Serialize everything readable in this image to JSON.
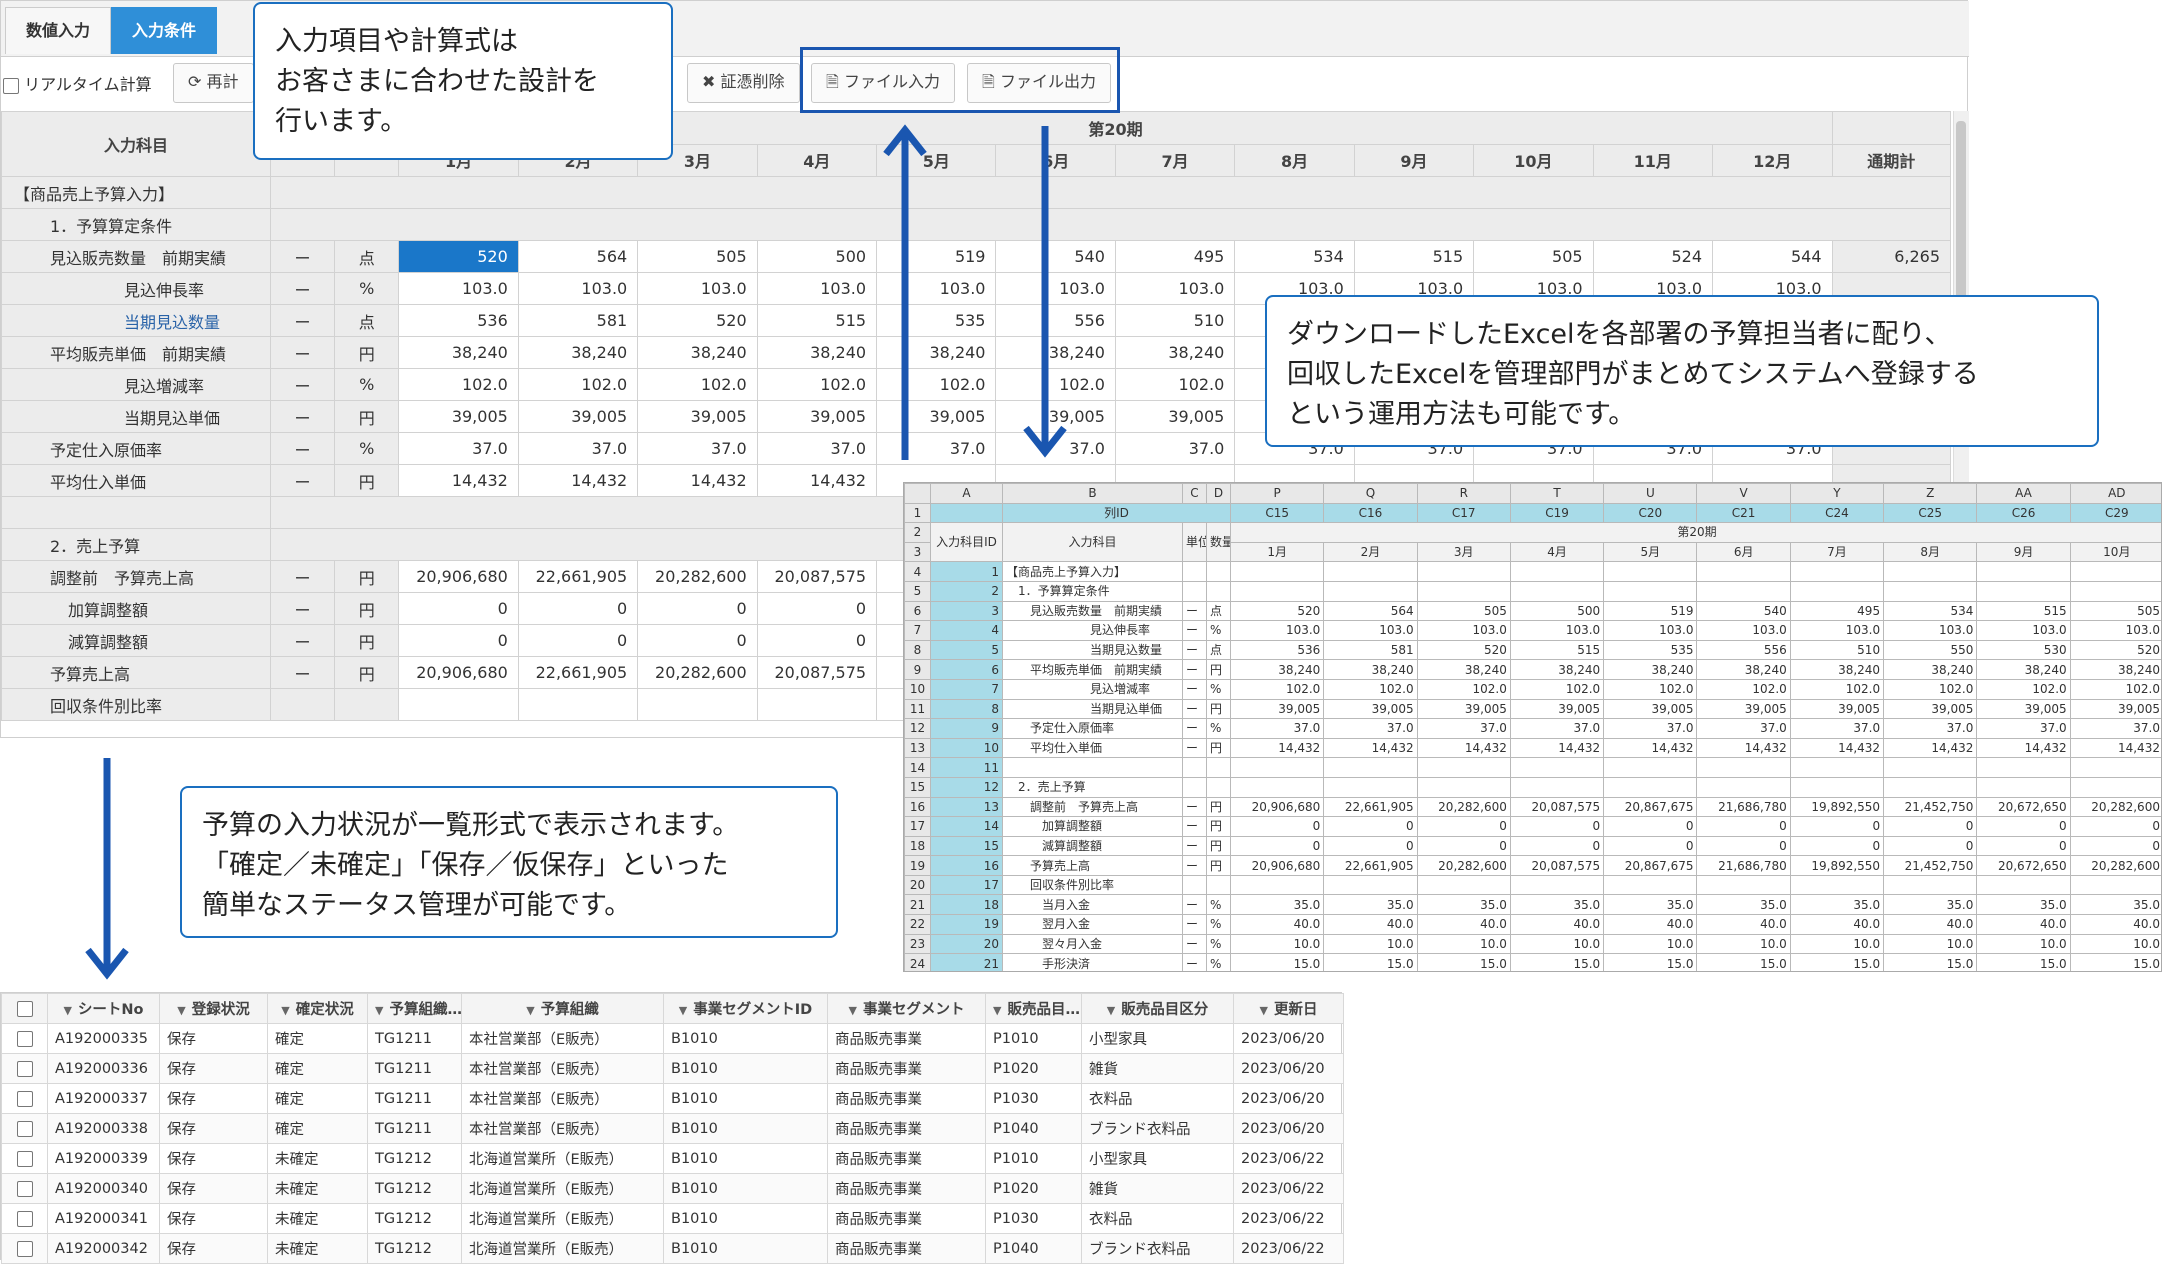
{
  "tabs": [
    "数値入力",
    "入力条件"
  ],
  "toolbar": {
    "realtime_label": "リアルタイム計算",
    "recalc_label": "再計",
    "delete_label": "証憑削除",
    "file_in_label": "ファイル入力",
    "file_out_label": "ファイル出力"
  },
  "main_grid": {
    "item_header": "入力科目",
    "period_header": "第20期",
    "months": [
      "1月",
      "2月",
      "3月",
      "4月",
      "5月",
      "6月",
      "7月",
      "8月",
      "9月",
      "10月",
      "11月",
      "12月"
    ],
    "total_header": "通期計",
    "rows": [
      {
        "label": "【商品売上予算入力】",
        "indent": 0,
        "type": "section"
      },
      {
        "label": "1．予算算定条件",
        "indent": 1,
        "type": "section"
      },
      {
        "label": "見込販売数量　前期実績",
        "indent": 1,
        "dash": "ー",
        "unit": "点",
        "values": [
          "520",
          "564",
          "505",
          "500",
          "519",
          "540",
          "495",
          "534",
          "515",
          "505",
          "524",
          "544"
        ],
        "total": "6,265"
      },
      {
        "label": "見込伸長率",
        "indent": 2,
        "dash": "ー",
        "unit": "%",
        "values": [
          "103.0",
          "103.0",
          "103.0",
          "103.0",
          "103.0",
          "103.0",
          "103.0",
          "103.0",
          "103.0",
          "103.0",
          "103.0",
          "103.0"
        ],
        "total": ""
      },
      {
        "label": "当期見込数量",
        "indent": 2,
        "dash": "ー",
        "unit": "点",
        "link": true,
        "values": [
          "536",
          "581",
          "520",
          "515",
          "535",
          "556",
          "510",
          "",
          "",
          "",
          "",
          ""
        ],
        "total": ""
      },
      {
        "label": "平均販売単価　前期実績",
        "indent": 1,
        "dash": "ー",
        "unit": "円",
        "values": [
          "38,240",
          "38,240",
          "38,240",
          "38,240",
          "38,240",
          "38,240",
          "38,240",
          "",
          "",
          "",
          "",
          ""
        ],
        "total": ""
      },
      {
        "label": "見込増減率",
        "indent": 2,
        "dash": "ー",
        "unit": "%",
        "values": [
          "102.0",
          "102.0",
          "102.0",
          "102.0",
          "102.0",
          "102.0",
          "102.0",
          "",
          "",
          "",
          "",
          ""
        ],
        "total": ""
      },
      {
        "label": "当期見込単価",
        "indent": 2,
        "dash": "ー",
        "unit": "円",
        "values": [
          "39,005",
          "39,005",
          "39,005",
          "39,005",
          "39,005",
          "39,005",
          "39,005",
          "",
          "",
          "",
          "",
          ""
        ],
        "total": ""
      },
      {
        "label": "予定仕入原価率",
        "indent": 1,
        "dash": "ー",
        "unit": "%",
        "values": [
          "37.0",
          "37.0",
          "37.0",
          "37.0",
          "37.0",
          "37.0",
          "37.0",
          "37.0",
          "37.0",
          "37.0",
          "37.0",
          "37.0"
        ],
        "total": ""
      },
      {
        "label": "平均仕入単価",
        "indent": 1,
        "dash": "ー",
        "unit": "円",
        "values": [
          "14,432",
          "14,432",
          "14,432",
          "14,432",
          "",
          "",
          "",
          "",
          "",
          "",
          "",
          ""
        ],
        "total": ""
      },
      {
        "label": "",
        "indent": 0,
        "type": "section"
      },
      {
        "label": "2．売上予算",
        "indent": 1,
        "type": "section"
      },
      {
        "label": "調整前　予算売上高",
        "indent": 1,
        "dash": "ー",
        "unit": "円",
        "values": [
          "20,906,680",
          "22,661,905",
          "20,282,600",
          "20,087,575",
          "",
          "",
          "",
          "",
          "",
          "",
          "",
          ""
        ],
        "total": ""
      },
      {
        "label": "加算調整額",
        "indent": 1.5,
        "dash": "ー",
        "unit": "円",
        "values": [
          "0",
          "0",
          "0",
          "0",
          "",
          "",
          "",
          "",
          "",
          "",
          "",
          ""
        ],
        "total": ""
      },
      {
        "label": "減算調整額",
        "indent": 1.5,
        "dash": "ー",
        "unit": "円",
        "values": [
          "0",
          "0",
          "0",
          "0",
          "",
          "",
          "",
          "",
          "",
          "",
          "",
          ""
        ],
        "total": ""
      },
      {
        "label": "予算売上高",
        "indent": 1,
        "dash": "ー",
        "unit": "円",
        "values": [
          "20,906,680",
          "22,661,905",
          "20,282,600",
          "20,087,575",
          "",
          "",
          "",
          "",
          "",
          "",
          "",
          ""
        ],
        "total": ""
      },
      {
        "label": "回収条件別比率",
        "indent": 1,
        "dash": "",
        "unit": "",
        "values": [
          "",
          "",
          "",
          "",
          "",
          "",
          "",
          "",
          "",
          "",
          "",
          ""
        ],
        "total": ""
      }
    ]
  },
  "callouts": {
    "top": [
      "入力項目や計算式は",
      "お客さまに合わせた設計を",
      "行います。"
    ],
    "right": [
      "ダウンロードしたExcelを各部署の予算担当者に配り、",
      "回収したExcelを管理部門がまとめてシステムへ登録する",
      "という運用方法も可能です。"
    ],
    "left": [
      "予算の入力状況が一覧形式で表示されます。",
      "「確定／未確定」「保存／仮保存」といった",
      "簡単なステータス管理が可能です。"
    ]
  },
  "excel": {
    "col_letters": [
      "A",
      "B",
      "C",
      "D",
      "P",
      "Q",
      "R",
      "T",
      "U",
      "V",
      "Y",
      "Z",
      "AA",
      "AD"
    ],
    "row1_label": "列ID",
    "col_ids": [
      "C15",
      "C16",
      "C17",
      "C19",
      "C20",
      "C21",
      "C24",
      "C25",
      "C26",
      "C29"
    ],
    "period": "第20期",
    "id_header": "入力科目ID",
    "item_header": "入力科目",
    "unit_header": "単位",
    "qty_header": "数量",
    "months": [
      "1月",
      "2月",
      "3月",
      "4月",
      "5月",
      "6月",
      "7月",
      "8月",
      "9月",
      "10月"
    ],
    "rows": [
      {
        "r": "4",
        "id": "1",
        "label": "【商品売上予算入力】",
        "u": "",
        "d": "",
        "v": []
      },
      {
        "r": "5",
        "id": "2",
        "label": "　1．予算算定条件",
        "u": "",
        "d": "",
        "v": []
      },
      {
        "r": "6",
        "id": "3",
        "label": "　　見込販売数量　前期実績",
        "u": "ー",
        "d": "点",
        "v": [
          "520",
          "564",
          "505",
          "500",
          "519",
          "540",
          "495",
          "534",
          "515",
          "505"
        ]
      },
      {
        "r": "7",
        "id": "4",
        "label": "　　　　　　　見込伸長率",
        "u": "ー",
        "d": "%",
        "v": [
          "103.0",
          "103.0",
          "103.0",
          "103.0",
          "103.0",
          "103.0",
          "103.0",
          "103.0",
          "103.0",
          "103.0"
        ]
      },
      {
        "r": "8",
        "id": "5",
        "label": "　　　　　　　当期見込数量",
        "u": "ー",
        "d": "点",
        "v": [
          "536",
          "581",
          "520",
          "515",
          "535",
          "556",
          "510",
          "550",
          "530",
          "520"
        ]
      },
      {
        "r": "9",
        "id": "6",
        "label": "　　平均販売単価　前期実績",
        "u": "ー",
        "d": "円",
        "v": [
          "38,240",
          "38,240",
          "38,240",
          "38,240",
          "38,240",
          "38,240",
          "38,240",
          "38,240",
          "38,240",
          "38,240"
        ]
      },
      {
        "r": "10",
        "id": "7",
        "label": "　　　　　　　見込増減率",
        "u": "ー",
        "d": "%",
        "v": [
          "102.0",
          "102.0",
          "102.0",
          "102.0",
          "102.0",
          "102.0",
          "102.0",
          "102.0",
          "102.0",
          "102.0"
        ]
      },
      {
        "r": "11",
        "id": "8",
        "label": "　　　　　　　当期見込単価",
        "u": "ー",
        "d": "円",
        "v": [
          "39,005",
          "39,005",
          "39,005",
          "39,005",
          "39,005",
          "39,005",
          "39,005",
          "39,005",
          "39,005",
          "39,005"
        ]
      },
      {
        "r": "12",
        "id": "9",
        "label": "　　予定仕入原価率",
        "u": "ー",
        "d": "%",
        "v": [
          "37.0",
          "37.0",
          "37.0",
          "37.0",
          "37.0",
          "37.0",
          "37.0",
          "37.0",
          "37.0",
          "37.0"
        ]
      },
      {
        "r": "13",
        "id": "10",
        "label": "　　平均仕入単価",
        "u": "ー",
        "d": "円",
        "v": [
          "14,432",
          "14,432",
          "14,432",
          "14,432",
          "14,432",
          "14,432",
          "14,432",
          "14,432",
          "14,432",
          "14,432"
        ]
      },
      {
        "r": "14",
        "id": "11",
        "label": "",
        "u": "",
        "d": "",
        "v": []
      },
      {
        "r": "15",
        "id": "12",
        "label": "　2．売上予算",
        "u": "",
        "d": "",
        "v": []
      },
      {
        "r": "16",
        "id": "13",
        "label": "　　調整前　予算売上高",
        "u": "ー",
        "d": "円",
        "v": [
          "20,906,680",
          "22,661,905",
          "20,282,600",
          "20,087,575",
          "20,867,675",
          "21,686,780",
          "19,892,550",
          "21,452,750",
          "20,672,650",
          "20,282,600"
        ]
      },
      {
        "r": "17",
        "id": "14",
        "label": "　　　加算調整額",
        "u": "ー",
        "d": "円",
        "v": [
          "0",
          "0",
          "0",
          "0",
          "0",
          "0",
          "0",
          "0",
          "0",
          "0"
        ]
      },
      {
        "r": "18",
        "id": "15",
        "label": "　　　減算調整額",
        "u": "ー",
        "d": "円",
        "v": [
          "0",
          "0",
          "0",
          "0",
          "0",
          "0",
          "0",
          "0",
          "0",
          "0"
        ]
      },
      {
        "r": "19",
        "id": "16",
        "label": "　　予算売上高",
        "u": "ー",
        "d": "円",
        "v": [
          "20,906,680",
          "22,661,905",
          "20,282,600",
          "20,087,575",
          "20,867,675",
          "21,686,780",
          "19,892,550",
          "21,452,750",
          "20,672,650",
          "20,282,600"
        ]
      },
      {
        "r": "20",
        "id": "17",
        "label": "　　回収条件別比率",
        "u": "",
        "d": "",
        "v": []
      },
      {
        "r": "21",
        "id": "18",
        "label": "　　　当月入金",
        "u": "ー",
        "d": "%",
        "v": [
          "35.0",
          "35.0",
          "35.0",
          "35.0",
          "35.0",
          "35.0",
          "35.0",
          "35.0",
          "35.0",
          "35.0"
        ]
      },
      {
        "r": "22",
        "id": "19",
        "label": "　　　翌月入金",
        "u": "ー",
        "d": "%",
        "v": [
          "40.0",
          "40.0",
          "40.0",
          "40.0",
          "40.0",
          "40.0",
          "40.0",
          "40.0",
          "40.0",
          "40.0"
        ]
      },
      {
        "r": "23",
        "id": "20",
        "label": "　　　翌々月入金",
        "u": "ー",
        "d": "%",
        "v": [
          "10.0",
          "10.0",
          "10.0",
          "10.0",
          "10.0",
          "10.0",
          "10.0",
          "10.0",
          "10.0",
          "10.0"
        ]
      },
      {
        "r": "24",
        "id": "21",
        "label": "　　　手形決済",
        "u": "ー",
        "d": "%",
        "v": [
          "15.0",
          "15.0",
          "15.0",
          "15.0",
          "15.0",
          "15.0",
          "15.0",
          "15.0",
          "15.0",
          "15.0"
        ]
      }
    ]
  },
  "status_list": {
    "headers": [
      "シートNo",
      "登録状況",
      "確定状況",
      "予算組織…",
      "予算組織",
      "事業セグメントID",
      "事業セグメント",
      "販売品目…",
      "販売品目区分",
      "更新日"
    ],
    "rows": [
      [
        "A192000335",
        "保存",
        "確定",
        "TG1211",
        "本社営業部（E販売）",
        "B1010",
        "商品販売事業",
        "P1010",
        "小型家具",
        "2023/06/20"
      ],
      [
        "A192000336",
        "保存",
        "確定",
        "TG1211",
        "本社営業部（E販売）",
        "B1010",
        "商品販売事業",
        "P1020",
        "雑貨",
        "2023/06/20"
      ],
      [
        "A192000337",
        "保存",
        "確定",
        "TG1211",
        "本社営業部（E販売）",
        "B1010",
        "商品販売事業",
        "P1030",
        "衣料品",
        "2023/06/20"
      ],
      [
        "A192000338",
        "保存",
        "確定",
        "TG1211",
        "本社営業部（E販売）",
        "B1010",
        "商品販売事業",
        "P1040",
        "ブランド衣料品",
        "2023/06/20"
      ],
      [
        "A192000339",
        "保存",
        "未確定",
        "TG1212",
        "北海道営業所（E販売）",
        "B1010",
        "商品販売事業",
        "P1010",
        "小型家具",
        "2023/06/22"
      ],
      [
        "A192000340",
        "保存",
        "未確定",
        "TG1212",
        "北海道営業所（E販売）",
        "B1010",
        "商品販売事業",
        "P1020",
        "雑貨",
        "2023/06/22"
      ],
      [
        "A192000341",
        "保存",
        "未確定",
        "TG1212",
        "北海道営業所（E販売）",
        "B1010",
        "商品販売事業",
        "P1030",
        "衣料品",
        "2023/06/22"
      ],
      [
        "A192000342",
        "保存",
        "未確定",
        "TG1212",
        "北海道営業所（E販売）",
        "B1010",
        "商品販売事業",
        "P1040",
        "ブランド衣料品",
        "2023/06/22"
      ]
    ]
  },
  "colors": {
    "accent": "#1a6fc0",
    "selected_cell": "#1a77c9",
    "excel_id_fill": "#a8dbe8",
    "tab_active": "#2f8fd8"
  },
  "icons": [
    "refresh-icon",
    "x-icon",
    "file-export-icon",
    "filter-icon",
    "arrow-up-icon",
    "arrow-down-icon"
  ]
}
